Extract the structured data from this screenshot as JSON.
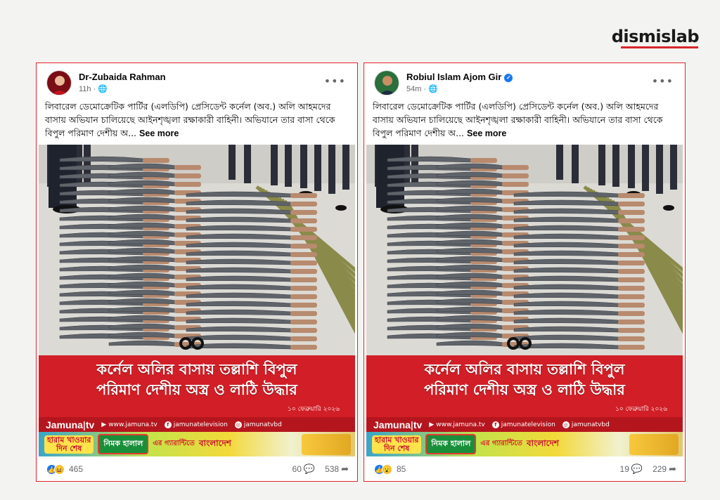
{
  "brand": "dismislab",
  "cards": [
    {
      "author": "Dr-Zubaida Rahman",
      "verified": false,
      "time": "11h",
      "privacy_icon": "globe-icon",
      "caption": "লিবারেল ডেমোক্রেটিক পার্টির (এলডিপি) প্রেসিডেন্ট কর্নেল (অব.) অলি আহমদের বাসায় অভিযান চালিয়েছে আইনশৃঙ্খলা রক্ষাকারী বাহিনী। অভিযানে তার বাসা থেকে বিপুল পরিমাণ দেশীয় অ...",
      "see_more": "See more",
      "headline_1": "কর্নেল অলির বাসায় তল্লাশি বিপুল",
      "headline_2": "পরিমাণ দেশীয় অস্ত্র ও লাঠি উদ্ধার",
      "banner_date": "১০ ফেব্রুয়ারি ২০২৬",
      "channel_logo": "Jamuna",
      "channel_suffix": "tv",
      "web": "www.jamuna.tv",
      "facebook": "jamunatelevision",
      "instagram": "jamunatvbd",
      "ad_a_1": "হারাম খাওয়ার",
      "ad_a_2": "দিন শেষ",
      "ad_b": "নিমক হালাল",
      "ad_c": "এর",
      "ad_c2": "গ্যারান্টিতে",
      "ad_d": "বাংলাদেশ",
      "reaction_icons": [
        "like-icon",
        "haha-icon"
      ],
      "reactions": "465",
      "comments": "60",
      "shares": "538"
    },
    {
      "author": "Robiul Islam Ajom Gir",
      "verified": true,
      "time": "54m",
      "privacy_icon": "globe-icon",
      "caption": "লিবারেল ডেমোক্রেটিক পার্টির (এলডিপি) প্রেসিডেন্ট কর্নেল (অব.) অলি আহমদের বাসায় অভিযান চালিয়েছে আইনশৃঙ্খলা রক্ষাকারী বাহিনী। অভিযানে তার বাসা থেকে বিপুল পরিমাণ দেশীয় অ...",
      "see_more": "See more",
      "headline_1": "কর্নেল অলির বাসায় তল্লাশি বিপুল",
      "headline_2": "পরিমাণ দেশীয় অস্ত্র ও লাঠি উদ্ধার",
      "banner_date": "১০ ফেব্রুয়ারি ২০২৬",
      "channel_logo": "Jamuna",
      "channel_suffix": "tv",
      "web": "www.jamuna.tv",
      "facebook": "jamunatelevision",
      "instagram": "jamunatvbd",
      "ad_a_1": "হারাম খাওয়ার",
      "ad_a_2": "দিন শেষ",
      "ad_b": "নিমক হালাল",
      "ad_c": "এর",
      "ad_c2": "গ্যারান্টিতে",
      "ad_d": "বাংলাদেশ",
      "reaction_icons": [
        "like-icon",
        "wow-icon"
      ],
      "reactions": "85",
      "comments": "19",
      "shares": "229"
    }
  ],
  "colors": {
    "frame": "#e2242a",
    "banner": "#d21e26",
    "brand_bar": "#d8262b"
  }
}
